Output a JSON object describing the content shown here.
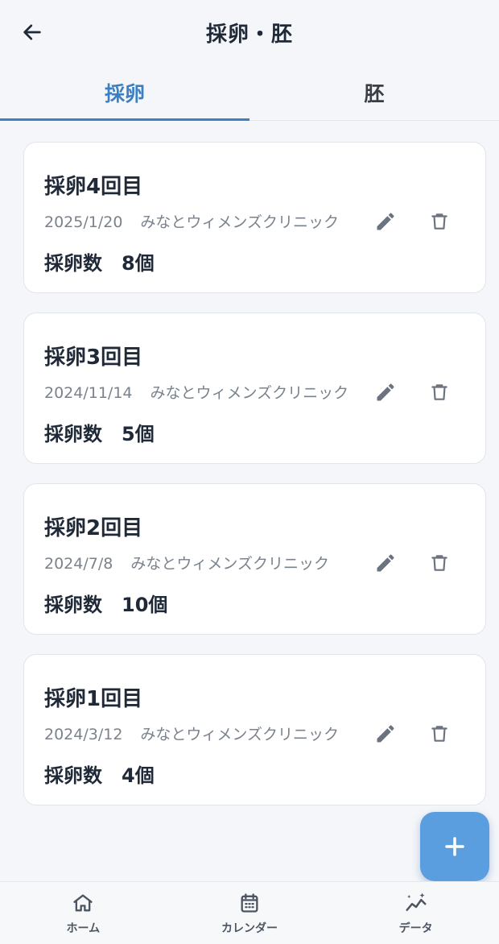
{
  "header": {
    "title": "採卵・胚"
  },
  "tabs": [
    {
      "label": "採卵",
      "active": true
    },
    {
      "label": "胚",
      "active": false
    }
  ],
  "records": [
    {
      "title": "採卵4回目",
      "date": "2025/1/20",
      "clinic": "みなとウィメンズクリニック",
      "count_label": "採卵数",
      "count_value": "8個"
    },
    {
      "title": "採卵3回目",
      "date": "2024/11/14",
      "clinic": "みなとウィメンズクリニック",
      "count_label": "採卵数",
      "count_value": "5個"
    },
    {
      "title": "採卵2回目",
      "date": "2024/7/8",
      "clinic": "みなとウィメンズクリニック",
      "count_label": "採卵数",
      "count_value": "10個"
    },
    {
      "title": "採卵1回目",
      "date": "2024/3/12",
      "clinic": "みなとウィメンズクリニック",
      "count_label": "採卵数",
      "count_value": "4個"
    }
  ],
  "bottom_nav": [
    {
      "label": "ホーム",
      "icon": "home-icon"
    },
    {
      "label": "カレンダー",
      "icon": "calendar-icon"
    },
    {
      "label": "データ",
      "icon": "chart-sparkle-icon"
    }
  ],
  "colors": {
    "accent": "#3d7fc1",
    "fab": "#5b9ee0",
    "muted_text": "#7a828c"
  }
}
